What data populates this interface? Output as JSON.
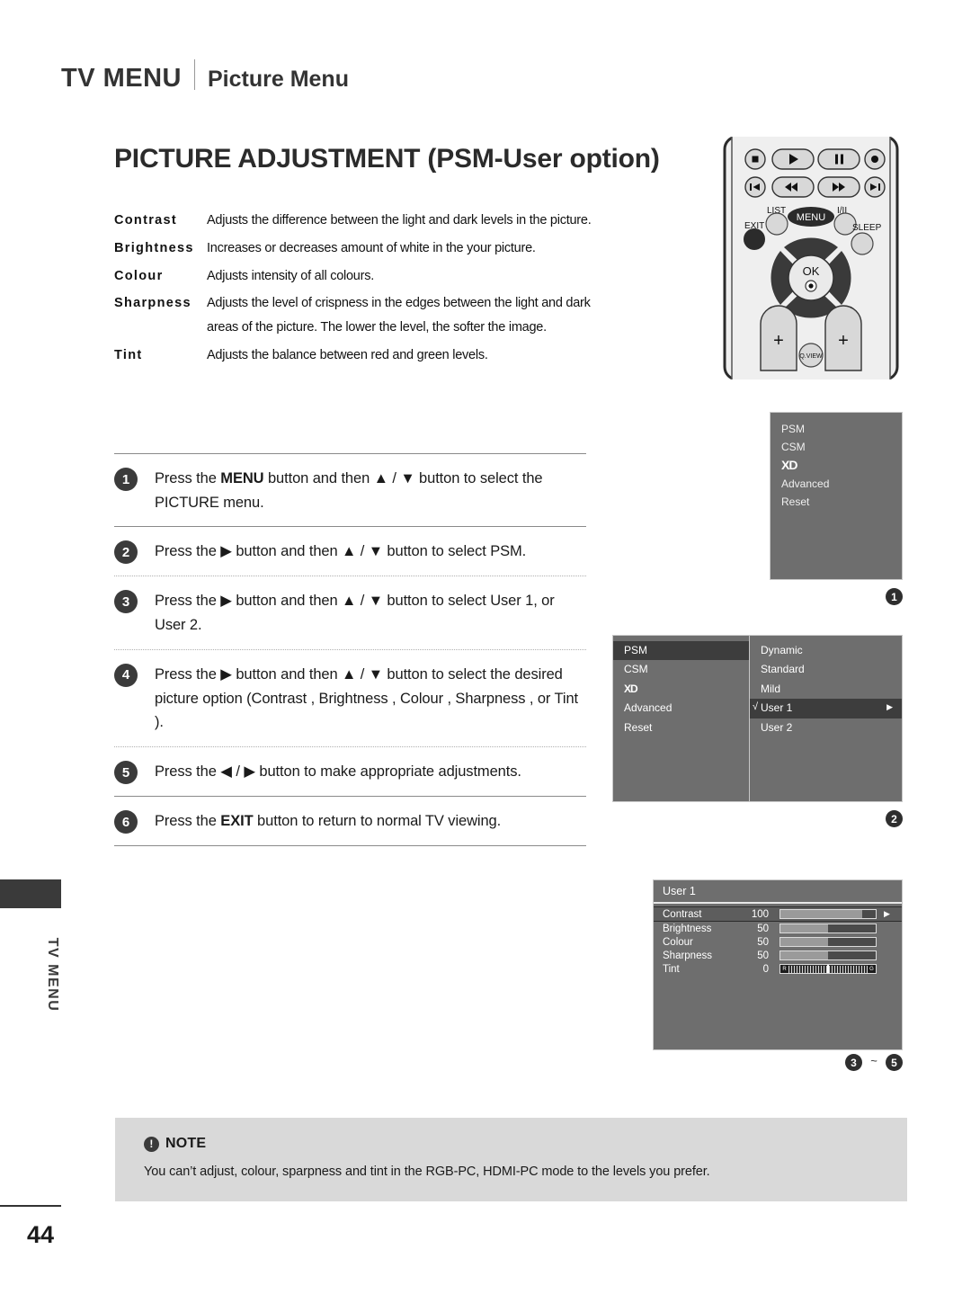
{
  "header": {
    "main_title": "TV MENU",
    "sub_title": "Picture Menu"
  },
  "page_title": "PICTURE ADJUSTMENT (PSM-User option)",
  "definitions": [
    {
      "term": "Contrast",
      "desc": "Adjusts the difference between the light and dark levels in the picture."
    },
    {
      "term": "Brightness",
      "desc": "Increases or decreases  amount of white in the your picture."
    },
    {
      "term": "Colour",
      "desc": "Adjusts intensity of all colours."
    },
    {
      "term": "Sharpness",
      "desc": "Adjusts the level of crispness in the edges between the light and dark areas of the picture. The lower the level, the softer the image."
    },
    {
      "term": "Tint",
      "desc": "Adjusts the balance between red and green levels."
    }
  ],
  "remote": {
    "transport_row1": [
      "stop-icon",
      "play-icon",
      "pause-icon",
      "record-icon"
    ],
    "transport_row2": [
      "skip-back-icon",
      "rewind-icon",
      "fast-forward-icon",
      "skip-forward-icon"
    ],
    "list_label": "LIST",
    "menu_label": "MENU",
    "iii_label": "I/II",
    "exit_label": "EXIT",
    "sleep_label": "SLEEP",
    "ok_label": "OK",
    "qview_label": "Q.VIEW",
    "plus_label": "+"
  },
  "steps": [
    {
      "num": "1",
      "parts": [
        {
          "t": "Press the ",
          "b": false
        },
        {
          "t": "MENU",
          "b": true
        },
        {
          "t": " button and then ▲ / ▼ button to select the PICTURE menu.",
          "b": false
        }
      ]
    },
    {
      "num": "2",
      "parts": [
        {
          "t": "Press the ▶ button and then ▲ / ▼ button to select PSM.",
          "b": false
        }
      ]
    },
    {
      "num": "3",
      "parts": [
        {
          "t": "Press the ▶ button and then ▲ / ▼ button to select User 1, or User 2.",
          "b": false
        }
      ]
    },
    {
      "num": "4",
      "parts": [
        {
          "t": "Press the ▶ button and then ▲ / ▼ button to select the desired picture option (Contrast , Brightness , Colour , Sharpness , or Tint ).",
          "b": false
        }
      ]
    },
    {
      "num": "5",
      "parts": [
        {
          "t": "Press the ◀ / ▶ button to make appropriate adjustments.",
          "b": false
        }
      ]
    },
    {
      "num": "6",
      "parts": [
        {
          "t": "Press the ",
          "b": false
        },
        {
          "t": "EXIT",
          "b": true
        },
        {
          "t": " button to return to normal TV viewing.",
          "b": false
        }
      ]
    }
  ],
  "osd1": {
    "items": [
      "PSM",
      "CSM",
      "XD",
      "Advanced",
      "Reset"
    ],
    "badge": "❶"
  },
  "osd2": {
    "left_items": [
      "PSM",
      "CSM",
      "XD",
      "Advanced",
      "Reset"
    ],
    "left_selected": "PSM",
    "right_items": [
      "Dynamic",
      "Standard",
      "Mild",
      "User 1",
      "User 2"
    ],
    "right_selected": "User 1",
    "check_glyph": "√",
    "arrow_glyph": "▶",
    "badge": "❷"
  },
  "osd3": {
    "title": "User 1",
    "rows": [
      {
        "label": "Contrast",
        "value": "100",
        "fill_pct": 86,
        "selected": true,
        "type": "bar"
      },
      {
        "label": "Brightness",
        "value": "50",
        "fill_pct": 50,
        "selected": false,
        "type": "bar"
      },
      {
        "label": "Colour",
        "value": "50",
        "fill_pct": 50,
        "selected": false,
        "type": "bar"
      },
      {
        "label": "Sharpness",
        "value": "50",
        "fill_pct": 50,
        "selected": false,
        "type": "bar"
      },
      {
        "label": "Tint",
        "value": "0",
        "fill_pct": 50,
        "selected": false,
        "type": "tint",
        "left_cap": "R",
        "right_cap": "G"
      }
    ],
    "arrow_glyph": "▶",
    "badge_from": "❸",
    "badge_tilde": "~",
    "badge_to": "❺"
  },
  "note": {
    "heading": "NOTE",
    "icon": "!",
    "body": "You can’t adjust, colour, sparpness and tint in the RGB-PC, HDMI-PC mode to the levels you prefer."
  },
  "side": {
    "label": "TV MENU",
    "page_number": "44"
  },
  "colors": {
    "osd_bg": "#6e6e6e",
    "osd_selected": "#3d3d3d",
    "note_bg": "#d9d9d9",
    "badge_bg": "#3b3b3b",
    "tab_bg": "#3a3a3a"
  }
}
